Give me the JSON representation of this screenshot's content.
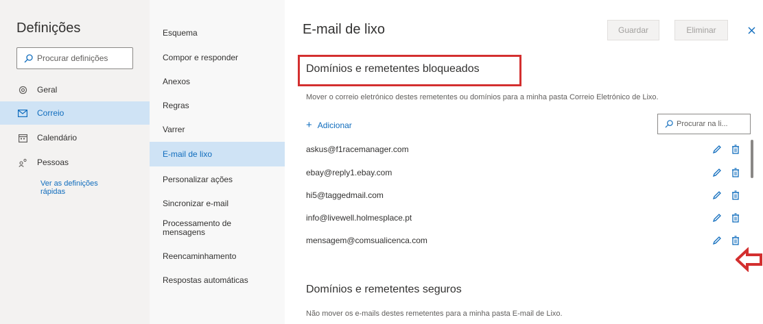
{
  "settings": {
    "title": "Definições",
    "search_placeholder": "Procurar definições"
  },
  "nav": {
    "items": [
      {
        "label": "Geral",
        "icon": "gear-icon"
      },
      {
        "label": "Correio",
        "icon": "mail-icon",
        "active": true
      },
      {
        "label": "Calendário",
        "icon": "calendar-icon"
      },
      {
        "label": "Pessoas",
        "icon": "people-icon"
      }
    ],
    "quick_settings_label": "Ver as definições rápidas"
  },
  "submenu": {
    "items": [
      {
        "label": "Esquema"
      },
      {
        "label": "Compor e responder"
      },
      {
        "label": "Anexos"
      },
      {
        "label": "Regras"
      },
      {
        "label": "Varrer"
      },
      {
        "label": "E-mail de lixo",
        "active": true
      },
      {
        "label": "Personalizar ações"
      },
      {
        "label": "Sincronizar e-mail"
      },
      {
        "label": "Processamento de mensagens"
      },
      {
        "label": "Reencaminhamento"
      },
      {
        "label": "Respostas automáticas"
      }
    ]
  },
  "main": {
    "title": "E-mail de lixo",
    "save_label": "Guardar",
    "delete_label": "Eliminar",
    "blocked": {
      "title": "Domínios e remetentes bloqueados",
      "description": "Mover o correio eletrónico destes remetentes ou domínios para a minha pasta Correio Eletrónico de Lixo.",
      "add_label": "Adicionar",
      "search_placeholder": "Procurar na li...",
      "entries": [
        "askus@f1racemanager.com",
        "ebay@reply1.ebay.com",
        "hi5@taggedmail.com",
        "info@livewell.holmesplace.pt",
        "mensagem@comsualicenca.com"
      ]
    },
    "safe": {
      "title": "Domínios e remetentes seguros",
      "description": "Não mover os e-mails destes remetentes para a minha pasta E-mail de Lixo."
    }
  },
  "colors": {
    "accent": "#0f6cbd",
    "selected_bg": "#cfe3f5",
    "annotation_red": "#d32f2f"
  }
}
